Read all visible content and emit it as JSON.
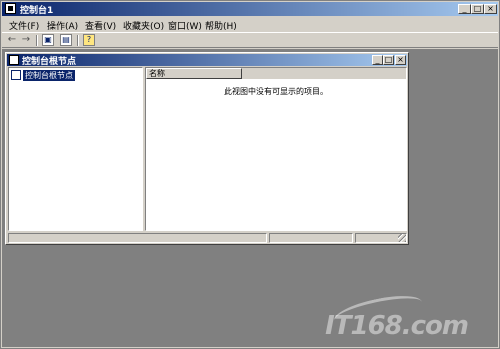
{
  "window": {
    "title": "控制台1"
  },
  "menu": [
    "文件(F)",
    "操作(A)",
    "查看(V)",
    "收藏夹(O)",
    "窗口(W)",
    "帮助(H)"
  ],
  "toolbar": {
    "back_icon": "back-arrow-icon",
    "forward_icon": "forward-arrow-icon",
    "tree_icon": "show-hide-tree-icon",
    "export_icon": "export-list-icon",
    "help_icon": "help-icon"
  },
  "child": {
    "title": "控制台根节点",
    "tree": {
      "root": "控制台根节点"
    },
    "list": {
      "column": "名称",
      "empty_message": "此视图中没有可显示的项目。"
    }
  },
  "watermark": "IT168.com",
  "colors": {
    "title_active": "#0a246a",
    "title_gradient_end": "#a6caf0",
    "face": "#d4d0c8",
    "mdi_bg": "#808080"
  }
}
